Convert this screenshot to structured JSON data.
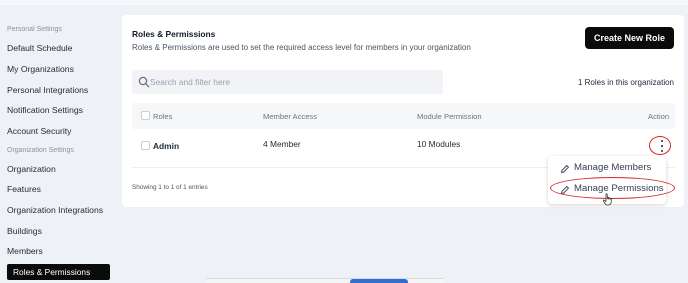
{
  "sidebar": {
    "section_personal": "Personal Settings",
    "personal_items": [
      "Default Schedule",
      "My Organizations",
      "Personal Integrations",
      "Notification Settings",
      "Account Security"
    ],
    "section_org": "Organization Settings",
    "org_items": [
      "Organization",
      "Features",
      "Organization Integrations",
      "Buildings",
      "Members"
    ],
    "active_item": "Roles & Permissions"
  },
  "card": {
    "title": "Roles & Permissions",
    "subtitle": "Roles & Permissions are used to set the required access level for members in your organization",
    "create_button": "Create New Role",
    "search_placeholder": "Search and filter here",
    "roles_count": "1 Roles in this organization"
  },
  "table": {
    "headers": [
      "Roles",
      "Member Access",
      "Module Permission",
      "Action"
    ],
    "rows": [
      {
        "role": "Admin",
        "member_access": "4 Member",
        "module_permission": "10 Modules"
      }
    ],
    "footer": "Showing 1 to 1 of 1 entries"
  },
  "action_menu": {
    "items": [
      "Manage Members",
      "Manage Permissions"
    ],
    "highlighted": "Manage Permissions"
  },
  "icons": {
    "search": "search-icon",
    "edit": "pencil-icon",
    "kebab": "more-vertical-icon",
    "cursor": "hand-pointer-icon"
  },
  "colors": {
    "primary_button": "#0b0b0b",
    "annotation": "#d9252a",
    "page_bg": "#eef1f6"
  }
}
